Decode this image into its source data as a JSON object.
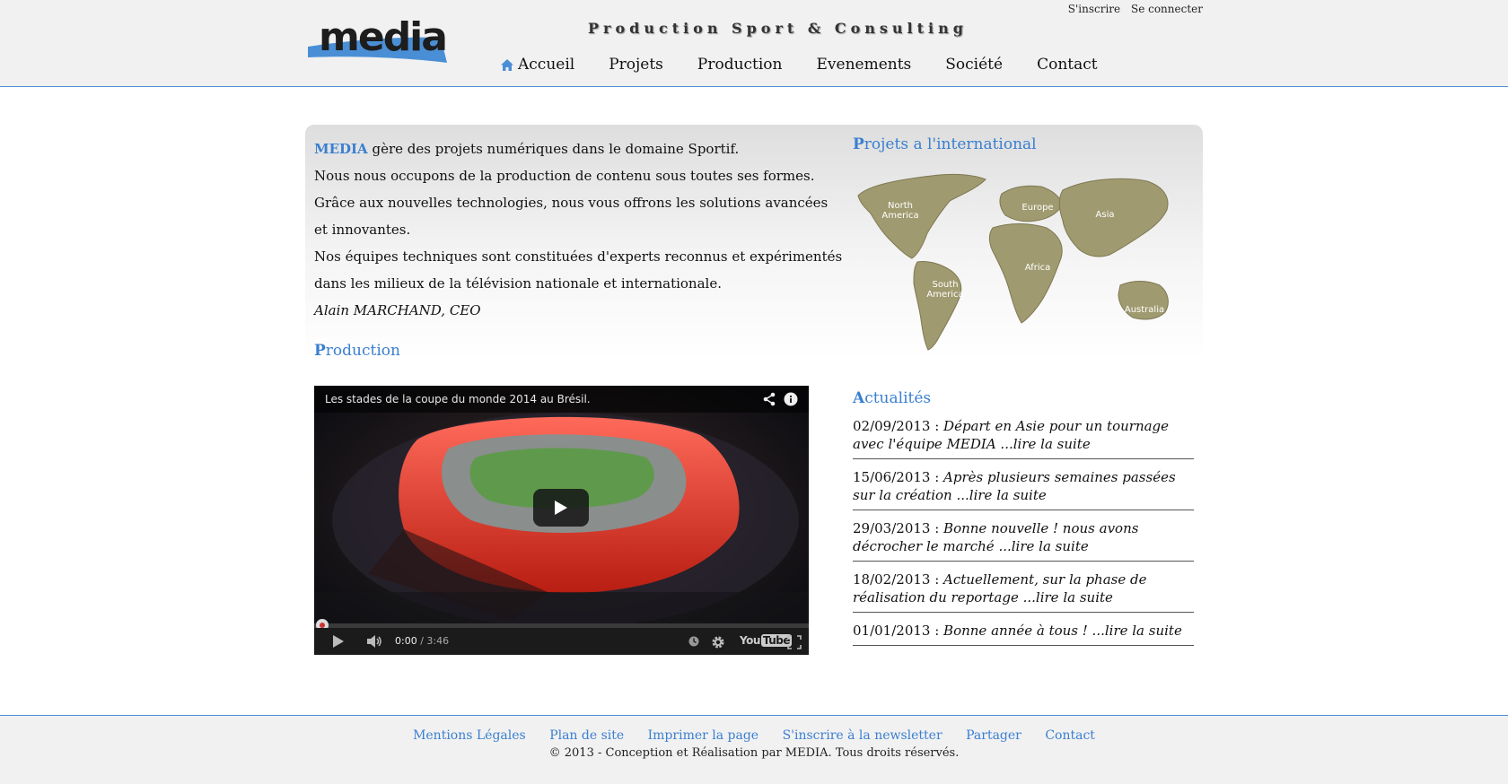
{
  "header": {
    "logo_text": "media",
    "tagline": "Production Sport & Consulting",
    "auth": {
      "signup": "S'inscrire",
      "login": "Se connecter"
    },
    "nav": [
      {
        "label": "Accueil",
        "icon": "home-icon"
      },
      {
        "label": "Projets"
      },
      {
        "label": "Production"
      },
      {
        "label": "Evenements"
      },
      {
        "label": "Société"
      },
      {
        "label": "Contact"
      }
    ]
  },
  "intro": {
    "brand": "MEDIA",
    "line1": " gère des projets numériques dans le domaine Sportif.",
    "line2": "Nous nous occupons de la production de contenu sous toutes ses formes.",
    "line3": "Grâce aux nouvelles technologies, nous vous offrons les solutions avancées et innovantes.",
    "line4": "Nos équipes techniques sont constituées d'experts reconnus et expérimentés dans les milieux de la télévision nationale et internationale.",
    "signature": "Alain MARCHAND, CEO"
  },
  "international": {
    "title_first": "P",
    "title_rest": "rojets a l'international",
    "regions": [
      "North America",
      "South America",
      "Europe",
      "Africa",
      "Asia",
      "Australia"
    ]
  },
  "production": {
    "title_first": "P",
    "title_rest": "roduction",
    "video": {
      "title": "Les stades de la coupe du monde 2014 au Brésil.",
      "current_time": "0:00",
      "duration": "/ 3:46",
      "progress": 0,
      "brand": "You",
      "brand_box": "Tube"
    }
  },
  "news": {
    "title_first": "A",
    "title_rest": "ctualités",
    "items": [
      {
        "date": "02/09/2013 : ",
        "text": "Départ en Asie pour un tournage avec l'équipe MEDIA ...lire la suite"
      },
      {
        "date": "15/06/2013 : ",
        "text": "Après plusieurs semaines passées sur la création ...lire la suite"
      },
      {
        "date": "29/03/2013 : ",
        "text": "Bonne nouvelle ! nous avons décrocher le marché ...lire la suite"
      },
      {
        "date": "18/02/2013 : ",
        "text": "Actuellement, sur la phase de réalisation du reportage ...lire la suite"
      },
      {
        "date": "01/01/2013 : ",
        "text": "Bonne année à tous ! ...lire la suite"
      }
    ]
  },
  "footer": {
    "links": [
      "Mentions Légales",
      "Plan de site",
      "Imprimer la page",
      "S'inscrire à la newsletter",
      "Partager",
      "Contact"
    ],
    "copyright": "© 2013 - Conception et Réalisation par MEDIA. Tous droits réservés."
  },
  "colors": {
    "accent": "#3a7fd0",
    "header_bg": "#f1f1f1",
    "map": "#a09a70"
  }
}
